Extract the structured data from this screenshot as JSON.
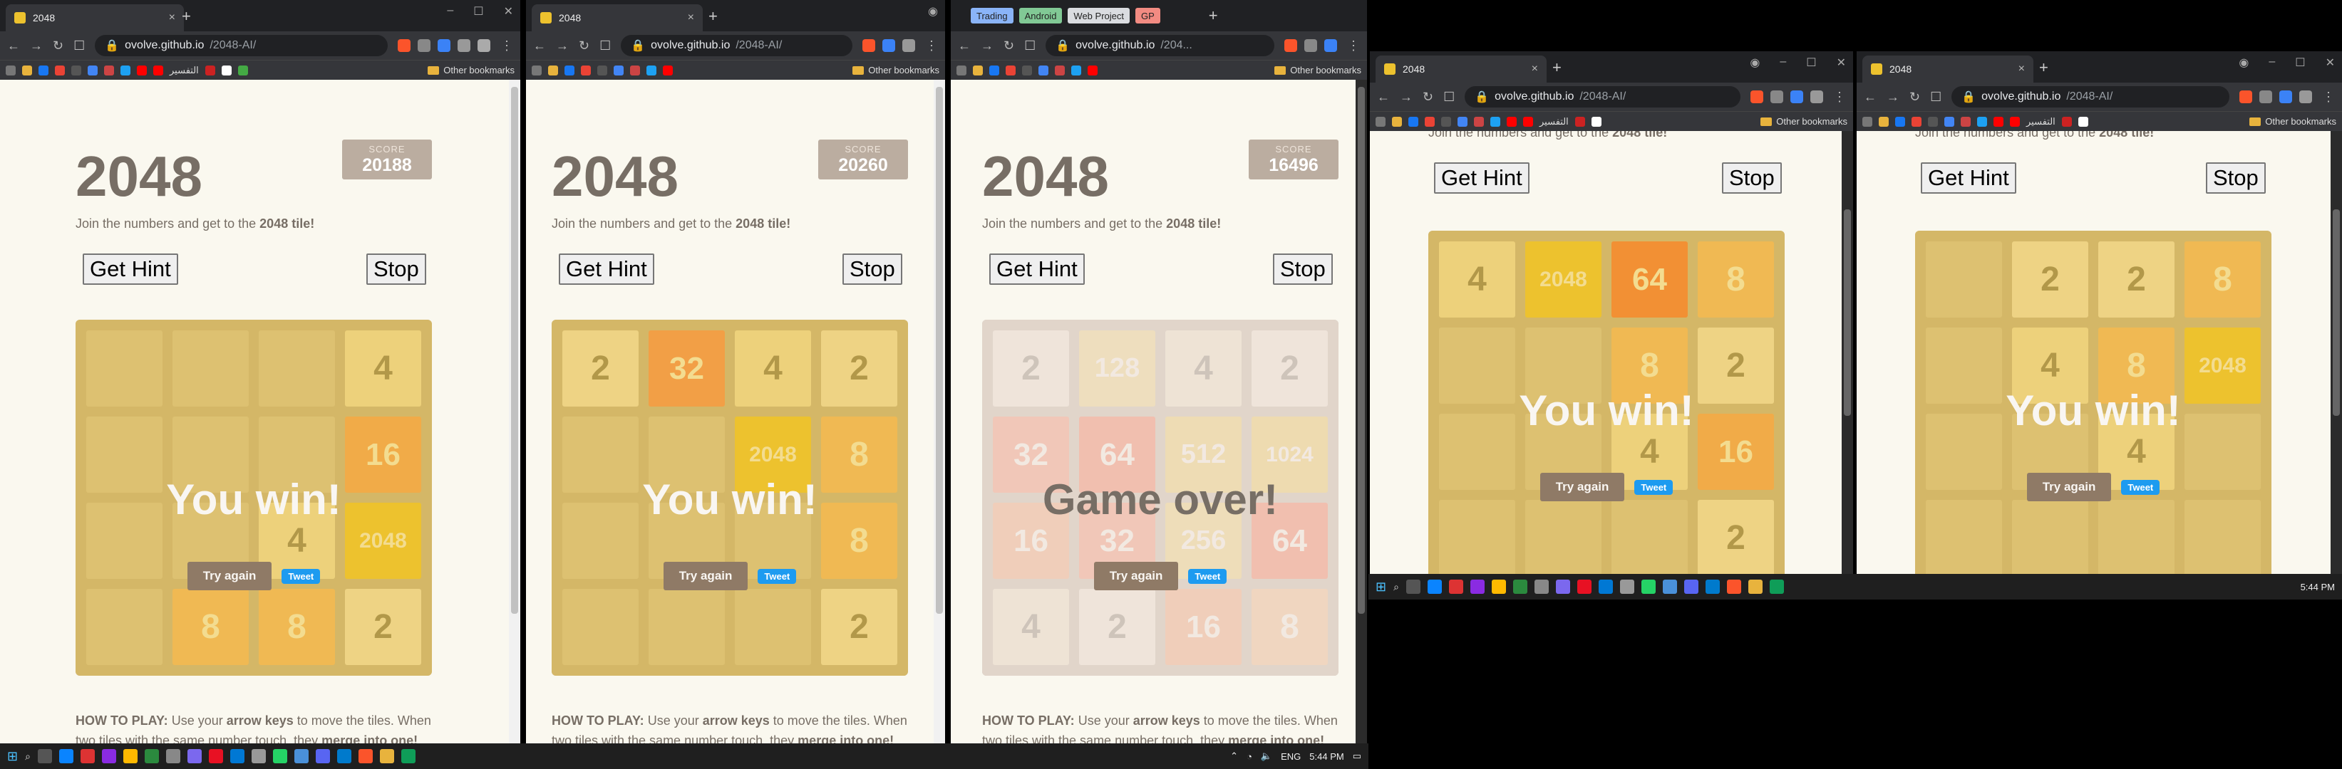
{
  "browser": {
    "tab_title": "2048",
    "url_host": "ovolve.github.io",
    "url_path": "/2048-AI/",
    "url_path_short": "/204...",
    "other_bookmarks": "Other bookmarks",
    "bookmark_text_1": "التفسير",
    "bookmark_text_2": "التفسير",
    "folders": [
      "Trading",
      "Android",
      "Web Project",
      "GP"
    ]
  },
  "game": {
    "title": "2048",
    "score_label": "SCORE",
    "intro_prefix": "Join the numbers and get to the ",
    "intro_bold": "2048 tile!",
    "hint_button": "Get Hint",
    "stop_button": "Stop",
    "try_again": "Try again",
    "tweet": "Tweet",
    "howto_label": "HOW TO PLAY:",
    "howto_text_1": " Use your ",
    "howto_keys": "arrow keys",
    "howto_text_2": " to move the tiles. When",
    "howto_line2_a": "two tiles with the same number touch, they ",
    "howto_line2_b": "merge into one!",
    "cut_intro_prefix": "Join the numbers and get to the ",
    "cut_intro_bold": "2048 tile!"
  },
  "windows": [
    {
      "score": "20188",
      "message": "You win!",
      "board": [
        [
          "",
          "",
          "",
          "4"
        ],
        [
          "",
          "",
          "",
          "16"
        ],
        [
          "",
          "",
          "4",
          "2048"
        ],
        [
          "",
          "8",
          "8",
          "2"
        ]
      ]
    },
    {
      "score": "20260",
      "message": "You win!",
      "board": [
        [
          "2",
          "32",
          "4",
          "2"
        ],
        [
          "",
          "",
          "2048",
          "8"
        ],
        [
          "",
          "",
          "",
          "8"
        ],
        [
          "",
          "",
          "",
          "2"
        ]
      ]
    },
    {
      "score": "16496",
      "message": "Game over!",
      "board": [
        [
          "2",
          "128",
          "4",
          "2"
        ],
        [
          "32",
          "64",
          "512",
          "1024"
        ],
        [
          "16",
          "32",
          "256",
          "64"
        ],
        [
          "4",
          "2",
          "16",
          "8"
        ]
      ]
    },
    {
      "message": "You win!",
      "board": [
        [
          "4",
          "2048",
          "64",
          "8"
        ],
        [
          "",
          "",
          "8",
          "2"
        ],
        [
          "",
          "",
          "4",
          "16"
        ],
        [
          "",
          "",
          "",
          "2"
        ]
      ]
    },
    {
      "message": "You win!",
      "board": [
        [
          "",
          "2",
          "2",
          "8"
        ],
        [
          "",
          "4",
          "8",
          "2048"
        ],
        [
          "",
          "",
          "4",
          ""
        ],
        [
          "",
          "",
          "",
          ""
        ]
      ]
    }
  ],
  "taskbar": {
    "lang": "ENG",
    "time_left": "5:44 PM",
    "time_right": "5:44 PM"
  },
  "colors": {
    "tile_empty": "#cdc1b4",
    "board": "#bbada0",
    "win_overlay": "rgba(237,194,46,0.5)",
    "over_overlay": "rgba(238,228,218,0.73)"
  }
}
